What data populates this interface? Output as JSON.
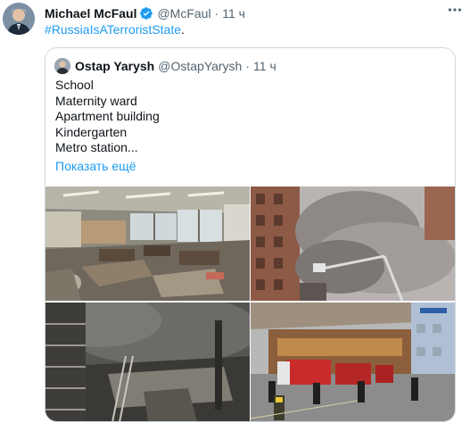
{
  "tweet": {
    "author_name": "Michael McFaul",
    "author_handle": "@McFaul",
    "separator": "·",
    "time": "11 ч",
    "hashtag": "#RussiaIsATerroristState",
    "trailing": "."
  },
  "quote": {
    "author_name": "Ostap Yarysh",
    "author_handle": "@OstapYarysh",
    "separator": "·",
    "time": "11 ч",
    "lines": [
      "School",
      "Maternity ward",
      "Apartment building",
      "Kindergarten",
      "Metro station..."
    ],
    "show_more": "Показать ещё"
  },
  "icons": {
    "verified": "verified-badge-icon",
    "more": "more-options-icon"
  },
  "colors": {
    "accent": "#1d9bf0",
    "text": "#0f1419",
    "secondary": "#536471",
    "border": "#cfd9de"
  }
}
